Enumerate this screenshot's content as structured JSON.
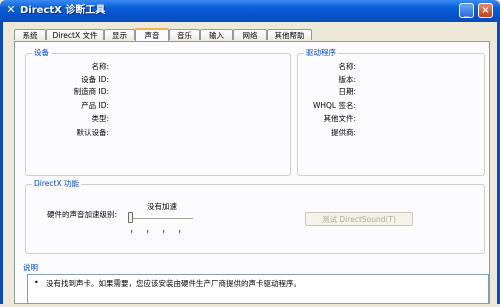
{
  "window": {
    "title": "DirectX 诊断工具",
    "icon": "dx-icon",
    "controls": {
      "minimize": "minimize-icon",
      "close": "close-icon"
    }
  },
  "tabs": [
    {
      "label": "系统"
    },
    {
      "label": "DirectX 文件"
    },
    {
      "label": "显示"
    },
    {
      "label": "声音",
      "active": true
    },
    {
      "label": "音乐"
    },
    {
      "label": "输入"
    },
    {
      "label": "网络"
    },
    {
      "label": "其他帮助"
    }
  ],
  "device": {
    "title": "设备",
    "fields": [
      {
        "label": "名称:"
      },
      {
        "label": "设备 ID:"
      },
      {
        "label": "制造商 ID:"
      },
      {
        "label": "产品 ID:"
      },
      {
        "label": "类型:"
      },
      {
        "label": "默认设备:"
      }
    ]
  },
  "driver": {
    "title": "驱动程序",
    "fields": [
      {
        "label": "名称:"
      },
      {
        "label": "版本:"
      },
      {
        "label": "日期:"
      },
      {
        "label": "WHQL 签名:"
      },
      {
        "label": "其他文件:"
      },
      {
        "label": "提供商:"
      }
    ]
  },
  "directx_features": {
    "title": "DirectX 功能",
    "accel_label": "硬件的声音加速级别:",
    "accel_value": "没有加速",
    "test_button": "测试 DirectSound(T)"
  },
  "notes": {
    "title": "说明",
    "items": [
      "没有找到声卡。如果需要，您应该安装由硬件生产厂商提供的声卡驱动程序。"
    ]
  },
  "colors": {
    "titlebar": "#0a5fd8",
    "group_title": "#0046d5",
    "active_tab_accent": "#f6b24a",
    "window_bg": "#ece9d8"
  }
}
